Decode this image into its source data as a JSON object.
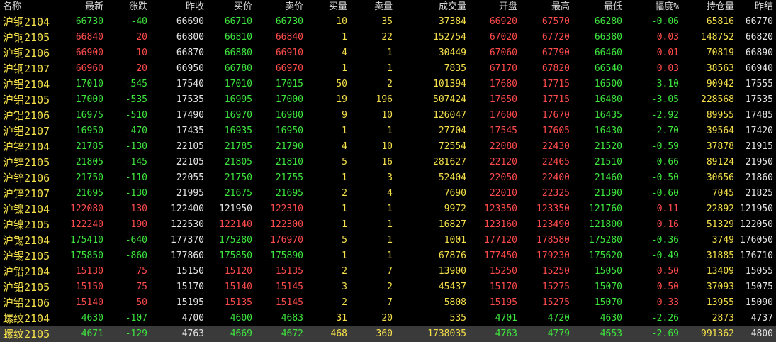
{
  "headers": [
    "名称",
    "最新",
    "涨跌",
    "昨收",
    "买价",
    "卖价",
    "买量",
    "卖量",
    "成交量",
    "开盘",
    "最高",
    "最低",
    "幅度%",
    "持仓量",
    "昨结"
  ],
  "rows": [
    {
      "name": "沪铜2104",
      "latest": "66730",
      "change": "-40",
      "prev_close": "66690",
      "bid": "66710",
      "ask": "66730",
      "bid_vol": "10",
      "ask_vol": "35",
      "volume": "37384",
      "open": "66920",
      "high": "67570",
      "low": "66280",
      "pct": "-0.06",
      "oi": "65816",
      "prev_settle": "66770",
      "c_latest": "green",
      "c_change": "green",
      "c_bid": "green",
      "c_ask": "green",
      "c_open": "red",
      "c_high": "red",
      "c_low": "green",
      "c_pct": "green"
    },
    {
      "name": "沪铜2105",
      "latest": "66840",
      "change": "20",
      "prev_close": "66800",
      "bid": "66810",
      "ask": "66840",
      "bid_vol": "1",
      "ask_vol": "22",
      "volume": "152754",
      "open": "67020",
      "high": "67720",
      "low": "66380",
      "pct": "0.03",
      "oi": "148752",
      "prev_settle": "66820",
      "c_latest": "red",
      "c_change": "red",
      "c_bid": "green",
      "c_ask": "red",
      "c_open": "red",
      "c_high": "red",
      "c_low": "green",
      "c_pct": "red"
    },
    {
      "name": "沪铜2106",
      "latest": "66900",
      "change": "10",
      "prev_close": "66870",
      "bid": "66880",
      "ask": "66910",
      "bid_vol": "4",
      "ask_vol": "1",
      "volume": "30449",
      "open": "67060",
      "high": "67790",
      "low": "66460",
      "pct": "0.01",
      "oi": "70819",
      "prev_settle": "66890",
      "c_latest": "red",
      "c_change": "red",
      "c_bid": "green",
      "c_ask": "red",
      "c_open": "red",
      "c_high": "red",
      "c_low": "green",
      "c_pct": "red"
    },
    {
      "name": "沪铜2107",
      "latest": "66960",
      "change": "20",
      "prev_close": "66950",
      "bid": "66780",
      "ask": "66970",
      "bid_vol": "1",
      "ask_vol": "1",
      "volume": "7835",
      "open": "67170",
      "high": "67820",
      "low": "66540",
      "pct": "0.03",
      "oi": "38563",
      "prev_settle": "66940",
      "c_latest": "red",
      "c_change": "red",
      "c_bid": "green",
      "c_ask": "red",
      "c_open": "red",
      "c_high": "red",
      "c_low": "green",
      "c_pct": "red"
    },
    {
      "name": "沪铝2104",
      "latest": "17010",
      "change": "-545",
      "prev_close": "17540",
      "bid": "17010",
      "ask": "17015",
      "bid_vol": "50",
      "ask_vol": "2",
      "volume": "101394",
      "open": "17680",
      "high": "17715",
      "low": "16500",
      "pct": "-3.10",
      "oi": "90942",
      "prev_settle": "17555",
      "c_latest": "green",
      "c_change": "green",
      "c_bid": "green",
      "c_ask": "green",
      "c_open": "red",
      "c_high": "red",
      "c_low": "green",
      "c_pct": "green"
    },
    {
      "name": "沪铝2105",
      "latest": "17000",
      "change": "-535",
      "prev_close": "17535",
      "bid": "16995",
      "ask": "17000",
      "bid_vol": "19",
      "ask_vol": "196",
      "volume": "507424",
      "open": "17650",
      "high": "17715",
      "low": "16480",
      "pct": "-3.05",
      "oi": "228568",
      "prev_settle": "17535",
      "c_latest": "green",
      "c_change": "green",
      "c_bid": "green",
      "c_ask": "green",
      "c_open": "red",
      "c_high": "red",
      "c_low": "green",
      "c_pct": "green"
    },
    {
      "name": "沪铝2106",
      "latest": "16975",
      "change": "-510",
      "prev_close": "17490",
      "bid": "16970",
      "ask": "16980",
      "bid_vol": "9",
      "ask_vol": "10",
      "volume": "126047",
      "open": "17600",
      "high": "17670",
      "low": "16435",
      "pct": "-2.92",
      "oi": "89955",
      "prev_settle": "17485",
      "c_latest": "green",
      "c_change": "green",
      "c_bid": "green",
      "c_ask": "green",
      "c_open": "red",
      "c_high": "red",
      "c_low": "green",
      "c_pct": "green"
    },
    {
      "name": "沪铝2107",
      "latest": "16950",
      "change": "-470",
      "prev_close": "17435",
      "bid": "16935",
      "ask": "16950",
      "bid_vol": "1",
      "ask_vol": "1",
      "volume": "27704",
      "open": "17545",
      "high": "17605",
      "low": "16430",
      "pct": "-2.70",
      "oi": "39564",
      "prev_settle": "17420",
      "c_latest": "green",
      "c_change": "green",
      "c_bid": "green",
      "c_ask": "green",
      "c_open": "red",
      "c_high": "red",
      "c_low": "green",
      "c_pct": "green"
    },
    {
      "name": "沪锌2104",
      "latest": "21785",
      "change": "-130",
      "prev_close": "22105",
      "bid": "21785",
      "ask": "21790",
      "bid_vol": "4",
      "ask_vol": "10",
      "volume": "72554",
      "open": "22080",
      "high": "22430",
      "low": "21520",
      "pct": "-0.59",
      "oi": "37878",
      "prev_settle": "21915",
      "c_latest": "green",
      "c_change": "green",
      "c_bid": "green",
      "c_ask": "green",
      "c_open": "red",
      "c_high": "red",
      "c_low": "green",
      "c_pct": "green"
    },
    {
      "name": "沪锌2105",
      "latest": "21805",
      "change": "-145",
      "prev_close": "22105",
      "bid": "21805",
      "ask": "21810",
      "bid_vol": "5",
      "ask_vol": "16",
      "volume": "281627",
      "open": "22120",
      "high": "22465",
      "low": "21510",
      "pct": "-0.66",
      "oi": "89124",
      "prev_settle": "21950",
      "c_latest": "green",
      "c_change": "green",
      "c_bid": "green",
      "c_ask": "green",
      "c_open": "red",
      "c_high": "red",
      "c_low": "green",
      "c_pct": "green"
    },
    {
      "name": "沪锌2106",
      "latest": "21750",
      "change": "-110",
      "prev_close": "22055",
      "bid": "21750",
      "ask": "21755",
      "bid_vol": "1",
      "ask_vol": "3",
      "volume": "52404",
      "open": "22050",
      "high": "22400",
      "low": "21460",
      "pct": "-0.50",
      "oi": "30656",
      "prev_settle": "21860",
      "c_latest": "green",
      "c_change": "green",
      "c_bid": "green",
      "c_ask": "green",
      "c_open": "red",
      "c_high": "red",
      "c_low": "green",
      "c_pct": "green"
    },
    {
      "name": "沪锌2107",
      "latest": "21695",
      "change": "-130",
      "prev_close": "21995",
      "bid": "21675",
      "ask": "21695",
      "bid_vol": "2",
      "ask_vol": "4",
      "volume": "7690",
      "open": "22010",
      "high": "22325",
      "low": "21390",
      "pct": "-0.60",
      "oi": "7045",
      "prev_settle": "21825",
      "c_latest": "green",
      "c_change": "green",
      "c_bid": "green",
      "c_ask": "green",
      "c_open": "red",
      "c_high": "red",
      "c_low": "green",
      "c_pct": "green"
    },
    {
      "name": "沪镍2104",
      "latest": "122080",
      "change": "130",
      "prev_close": "122400",
      "bid": "121950",
      "ask": "122310",
      "bid_vol": "1",
      "ask_vol": "1",
      "volume": "9972",
      "open": "123350",
      "high": "123350",
      "low": "121760",
      "pct": "0.11",
      "oi": "22892",
      "prev_settle": "121950",
      "c_latest": "red",
      "c_change": "red",
      "c_bid": "white",
      "c_ask": "red",
      "c_open": "red",
      "c_high": "red",
      "c_low": "green",
      "c_pct": "red"
    },
    {
      "name": "沪镍2105",
      "latest": "122240",
      "change": "190",
      "prev_close": "122530",
      "bid": "122140",
      "ask": "122300",
      "bid_vol": "1",
      "ask_vol": "1",
      "volume": "16827",
      "open": "123160",
      "high": "123490",
      "low": "121800",
      "pct": "0.16",
      "oi": "51329",
      "prev_settle": "122050",
      "c_latest": "red",
      "c_change": "red",
      "c_bid": "red",
      "c_ask": "red",
      "c_open": "red",
      "c_high": "red",
      "c_low": "green",
      "c_pct": "red"
    },
    {
      "name": "沪锡2104",
      "latest": "175410",
      "change": "-640",
      "prev_close": "177370",
      "bid": "175280",
      "ask": "176970",
      "bid_vol": "5",
      "ask_vol": "1",
      "volume": "1001",
      "open": "177120",
      "high": "178580",
      "low": "175280",
      "pct": "-0.36",
      "oi": "3749",
      "prev_settle": "176050",
      "c_latest": "green",
      "c_change": "green",
      "c_bid": "green",
      "c_ask": "red",
      "c_open": "red",
      "c_high": "red",
      "c_low": "green",
      "c_pct": "green"
    },
    {
      "name": "沪锡2105",
      "latest": "175850",
      "change": "-860",
      "prev_close": "177860",
      "bid": "175850",
      "ask": "175890",
      "bid_vol": "1",
      "ask_vol": "1",
      "volume": "67876",
      "open": "177450",
      "high": "179230",
      "low": "175620",
      "pct": "-0.49",
      "oi": "31885",
      "prev_settle": "176710",
      "c_latest": "green",
      "c_change": "green",
      "c_bid": "green",
      "c_ask": "green",
      "c_open": "red",
      "c_high": "red",
      "c_low": "green",
      "c_pct": "green"
    },
    {
      "name": "沪铅2104",
      "latest": "15130",
      "change": "75",
      "prev_close": "15150",
      "bid": "15120",
      "ask": "15135",
      "bid_vol": "2",
      "ask_vol": "7",
      "volume": "13900",
      "open": "15250",
      "high": "15250",
      "low": "15050",
      "pct": "0.50",
      "oi": "13409",
      "prev_settle": "15055",
      "c_latest": "red",
      "c_change": "red",
      "c_bid": "red",
      "c_ask": "red",
      "c_open": "red",
      "c_high": "red",
      "c_low": "green",
      "c_pct": "red"
    },
    {
      "name": "沪铅2105",
      "latest": "15150",
      "change": "75",
      "prev_close": "15170",
      "bid": "15140",
      "ask": "15145",
      "bid_vol": "3",
      "ask_vol": "2",
      "volume": "45437",
      "open": "15170",
      "high": "15275",
      "low": "15070",
      "pct": "0.50",
      "oi": "37093",
      "prev_settle": "15075",
      "c_latest": "red",
      "c_change": "red",
      "c_bid": "red",
      "c_ask": "red",
      "c_open": "red",
      "c_high": "red",
      "c_low": "green",
      "c_pct": "red"
    },
    {
      "name": "沪铅2106",
      "latest": "15140",
      "change": "50",
      "prev_close": "15195",
      "bid": "15135",
      "ask": "15145",
      "bid_vol": "2",
      "ask_vol": "7",
      "volume": "5808",
      "open": "15195",
      "high": "15275",
      "low": "15070",
      "pct": "0.33",
      "oi": "13955",
      "prev_settle": "15090",
      "c_latest": "red",
      "c_change": "red",
      "c_bid": "red",
      "c_ask": "red",
      "c_open": "red",
      "c_high": "red",
      "c_low": "green",
      "c_pct": "red"
    },
    {
      "name": "螺纹2104",
      "latest": "4630",
      "change": "-107",
      "prev_close": "4700",
      "bid": "4600",
      "ask": "4683",
      "bid_vol": "31",
      "ask_vol": "20",
      "volume": "535",
      "open": "4701",
      "high": "4720",
      "low": "4630",
      "pct": "-2.26",
      "oi": "2873",
      "prev_settle": "4737",
      "c_latest": "green",
      "c_change": "green",
      "c_bid": "green",
      "c_ask": "green",
      "c_open": "green",
      "c_high": "green",
      "c_low": "green",
      "c_pct": "green"
    },
    {
      "name": "螺纹2105",
      "latest": "4671",
      "change": "-129",
      "prev_close": "4763",
      "bid": "4669",
      "ask": "4672",
      "bid_vol": "468",
      "ask_vol": "360",
      "volume": "1738035",
      "open": "4763",
      "high": "4779",
      "low": "4653",
      "pct": "-2.69",
      "oi": "991362",
      "prev_settle": "4800",
      "selected": true,
      "c_latest": "green",
      "c_change": "green",
      "c_bid": "green",
      "c_ask": "green",
      "c_open": "green",
      "c_high": "green",
      "c_low": "green",
      "c_pct": "green"
    }
  ]
}
